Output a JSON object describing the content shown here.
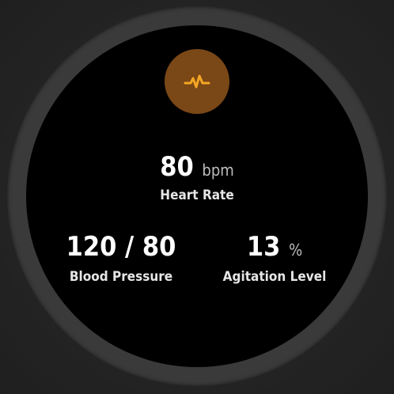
{
  "colors": {
    "accent": "#F5A623",
    "badge_background": "#7A4716",
    "screen_background": "#000000",
    "bezel": "#3A3A3A"
  },
  "icon": {
    "name": "heart-pulse-icon"
  },
  "heart_rate": {
    "value": "80",
    "unit": "bpm",
    "label": "Heart Rate"
  },
  "blood_pressure": {
    "value": "120 / 80",
    "label": "Blood Pressure"
  },
  "agitation": {
    "value": "13",
    "unit": "%",
    "label": "Agitation Level"
  }
}
